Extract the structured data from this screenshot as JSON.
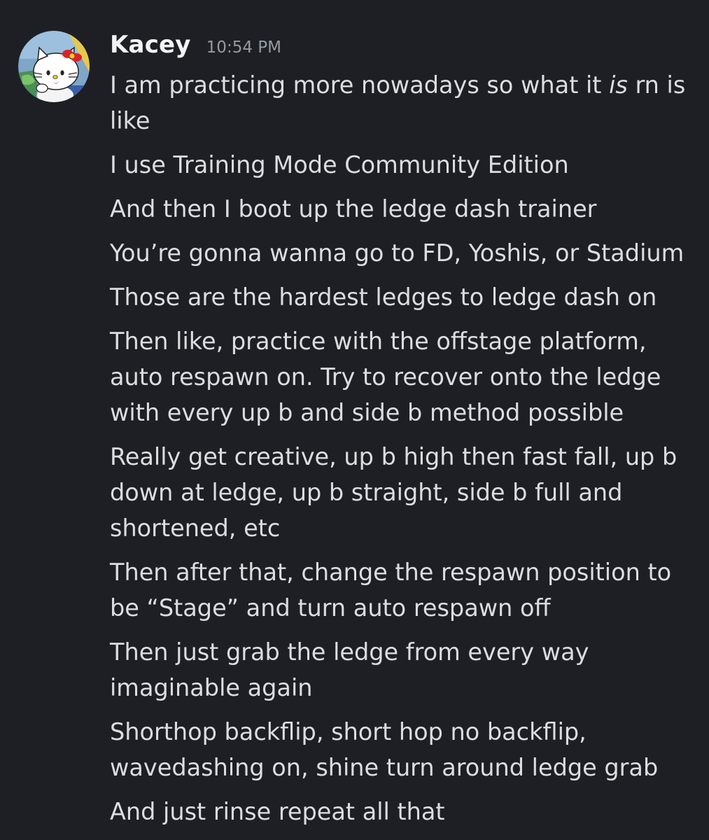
{
  "author": {
    "username": "Kacey",
    "timestamp": "10:54 PM",
    "avatar_icon": "hello-kitty-avatar"
  },
  "colors": {
    "background": "#1e1f24",
    "username": "#f2f3f5",
    "timestamp": "#949ba4",
    "message_text": "#dbdee1"
  },
  "messages": [
    {
      "lines": [
        {
          "before": "I am practicing more nowadays so what it ",
          "emphasis": "is",
          "after": " rn is"
        },
        {
          "text": "like"
        }
      ]
    },
    {
      "lines": [
        {
          "text": "I use Training Mode Community Edition"
        }
      ]
    },
    {
      "lines": [
        {
          "text": "And then I boot up the ledge dash trainer"
        }
      ]
    },
    {
      "lines": [
        {
          "text": "You’re gonna wanna go to FD, Yoshis, or Stadium"
        }
      ]
    },
    {
      "lines": [
        {
          "text": "Those are the hardest ledges to ledge dash on"
        }
      ]
    },
    {
      "lines": [
        {
          "text": "Then like, practice with the offstage platform,"
        },
        {
          "text": "auto respawn on. Try to recover onto the ledge"
        },
        {
          "text": "with every up b and side b method possible"
        }
      ]
    },
    {
      "lines": [
        {
          "text": "Really get creative, up b high then fast fall, up b"
        },
        {
          "text": "down at ledge, up b straight, side b full and"
        },
        {
          "text": "shortened, etc"
        }
      ]
    },
    {
      "lines": [
        {
          "text": "Then after that, change the respawn position to"
        },
        {
          "text": "be “Stage” and turn auto respawn off"
        }
      ]
    },
    {
      "lines": [
        {
          "text": "Then just grab the ledge from every way"
        },
        {
          "text": "imaginable again"
        }
      ]
    },
    {
      "lines": [
        {
          "text": "Shorthop backflip, short hop no backflip,"
        },
        {
          "text": "wavedashing on, shine turn around ledge grab"
        }
      ]
    },
    {
      "lines": [
        {
          "text": "And just rinse repeat all that"
        }
      ]
    }
  ]
}
